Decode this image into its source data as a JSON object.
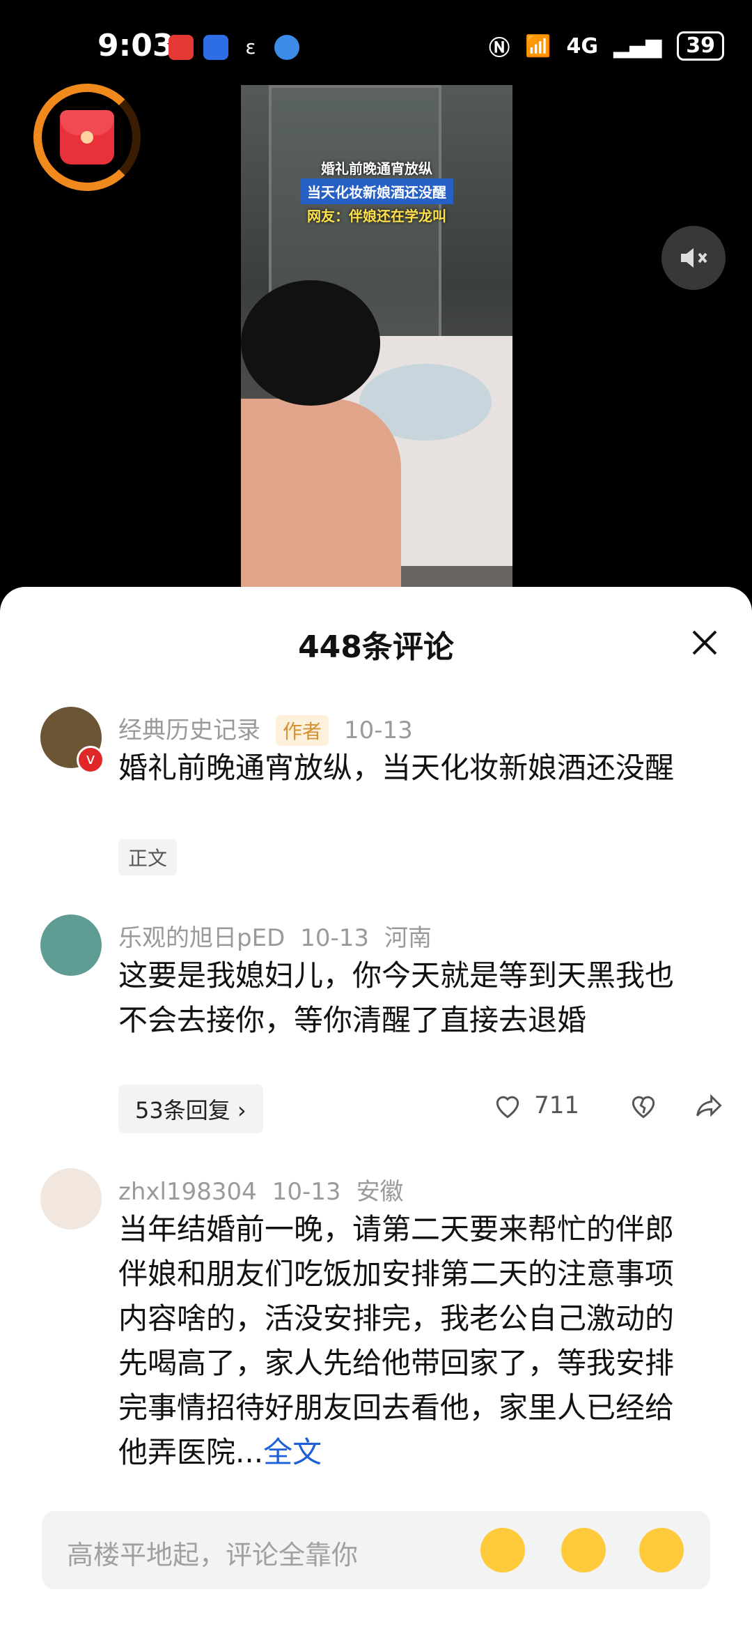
{
  "status": {
    "time": "9:03",
    "network": "4G",
    "battery": "39"
  },
  "video": {
    "caption_line1": "婚礼前晚通宵放纵",
    "caption_line2": "当天化妆新娘酒还没醒",
    "caption_line3": "网友：伴娘还在学龙叫"
  },
  "sheet": {
    "title": "448条评论",
    "comments": [
      {
        "user": "经典历史记录",
        "author_tag": "作者",
        "date": "10-13",
        "text": "婚礼前晚通宵放纵，当天化妆新娘酒还没醒",
        "tag": "正文"
      },
      {
        "user": "乐观的旭日pED",
        "date": "10-13",
        "location": "河南",
        "text": "这要是我媳妇儿，你今天就是等到天黑我也不会去接你，等你清醒了直接去退婚",
        "replies": "53条回复",
        "likes": "711"
      },
      {
        "user": "zhxl198304",
        "date": "10-13",
        "location": "安徽",
        "text": "当年结婚前一晚，请第二天要来帮忙的伴郎伴娘和朋友们吃饭加安排第二天的注意事项内容啥的，活没安排完，我老公自己激动的先喝高了，家人先给他带回家了，等我安排完事情招待好朋友回去看他，家里人已经给他弄医院...",
        "more": "全文"
      }
    ]
  },
  "input": {
    "placeholder": "高楼平地起，评论全靠你"
  },
  "icons": {
    "red_packet": "red-envelope-icon",
    "mute": "speaker-muted-icon",
    "close": "close-icon",
    "like": "heart-icon",
    "dislike": "broken-heart-icon",
    "share": "share-arrow-icon"
  }
}
